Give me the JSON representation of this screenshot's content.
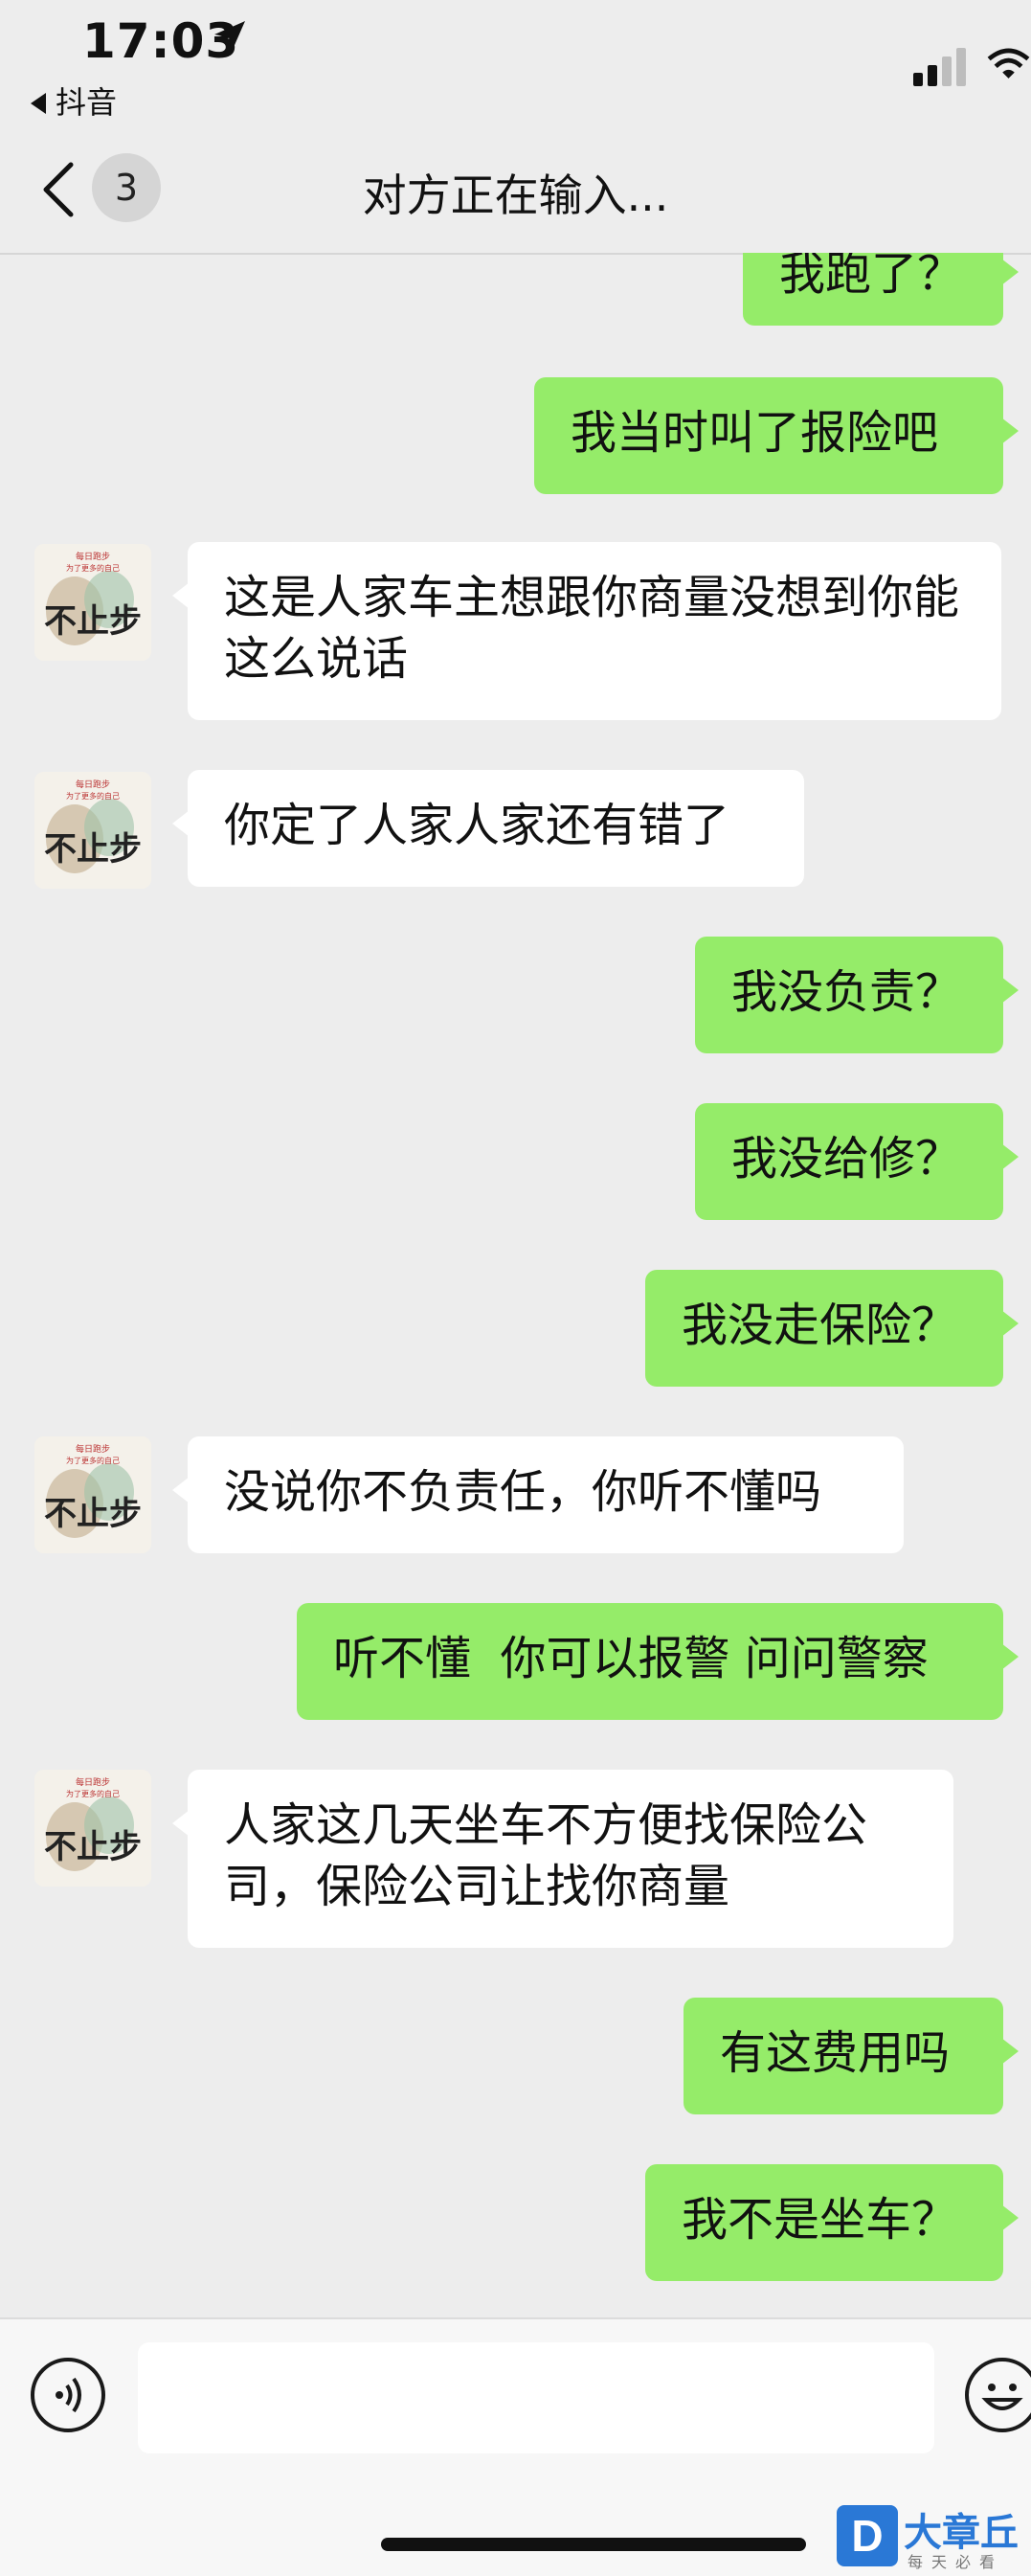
{
  "status_bar": {
    "time": "17:03",
    "back_app": "抖音",
    "icons": [
      "location-arrow-icon",
      "signal-icon",
      "wifi-icon"
    ]
  },
  "nav": {
    "badge": "3",
    "title": "对方正在输入..."
  },
  "avatar_text": {
    "line1": "每日跑步",
    "line2": "为了更多的自己",
    "brand": "不止步"
  },
  "messages": [
    {
      "side": "me",
      "text": "我跑了？"
    },
    {
      "side": "me",
      "text": "我当时叫了报险吧"
    },
    {
      "side": "them",
      "text": "这是人家车主想跟你商量没想到你能这么说话"
    },
    {
      "side": "them",
      "text": "你定了人家人家还有错了"
    },
    {
      "side": "me",
      "text": "我没负责？"
    },
    {
      "side": "me",
      "text": "我没给修？"
    },
    {
      "side": "me",
      "text": "我没走保险？"
    },
    {
      "side": "them",
      "text": "没说你不负责任，你听不懂吗"
    },
    {
      "side": "me",
      "text": "听不懂  你可以报警 问问警察"
    },
    {
      "side": "them",
      "text": "人家这几天坐车不方便找保险公司，保险公司让找你商量"
    },
    {
      "side": "me",
      "text": "有这费用吗"
    },
    {
      "side": "me",
      "text": "我不是坐车？"
    }
  ],
  "input": {
    "placeholder": ""
  },
  "watermark": {
    "logo": "D",
    "name": "大章丘",
    "slogan": "每天必看"
  },
  "colors": {
    "background": "#ededed",
    "my_bubble": "#95ec69",
    "their_bubble": "#ffffff"
  }
}
